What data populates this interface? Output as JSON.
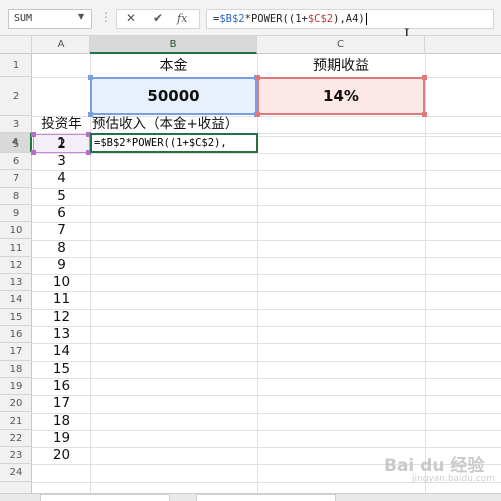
{
  "formula_bar": {
    "name_box": "SUM",
    "cancel_glyph": "✕",
    "enter_glyph": "✔",
    "fx_glyph": "fx",
    "formula_parts": {
      "p1": "=",
      "p2": "$B$2",
      "p3": "*POWER((1+",
      "p4": "$C$2",
      "p5": "),A4)"
    }
  },
  "columns": [
    "A",
    "B",
    "C"
  ],
  "rows": [
    "1",
    "2",
    "3",
    "4",
    "5",
    "6",
    "7",
    "8",
    "9",
    "10",
    "11",
    "12",
    "13",
    "14",
    "15",
    "16",
    "17",
    "18",
    "19",
    "20",
    "21",
    "22",
    "23",
    "24"
  ],
  "cells": {
    "B1": "本金",
    "C1": "预期收益",
    "B2": "50000",
    "C2": "14%",
    "A3": "投资年",
    "B3": "预估收入（本金+收益）",
    "A4": "1",
    "B4": "=$B$2*POWER((1+$C$2),",
    "A_years": [
      "2",
      "3",
      "4",
      "5",
      "6",
      "7",
      "8",
      "9",
      "10",
      "11",
      "12",
      "13",
      "14",
      "15",
      "16",
      "17",
      "18",
      "19",
      "20"
    ]
  },
  "colors": {
    "header_selected": "#217346",
    "ref_b": "#2f64c8",
    "ref_c": "#c23a3a",
    "b2_fill": "#e7f0fb",
    "c2_fill": "#fde8e8",
    "a4_fill": "#f4eef8"
  },
  "watermark": {
    "brand": "Bai du 经验",
    "sub": "jingyan.baidu.com"
  }
}
